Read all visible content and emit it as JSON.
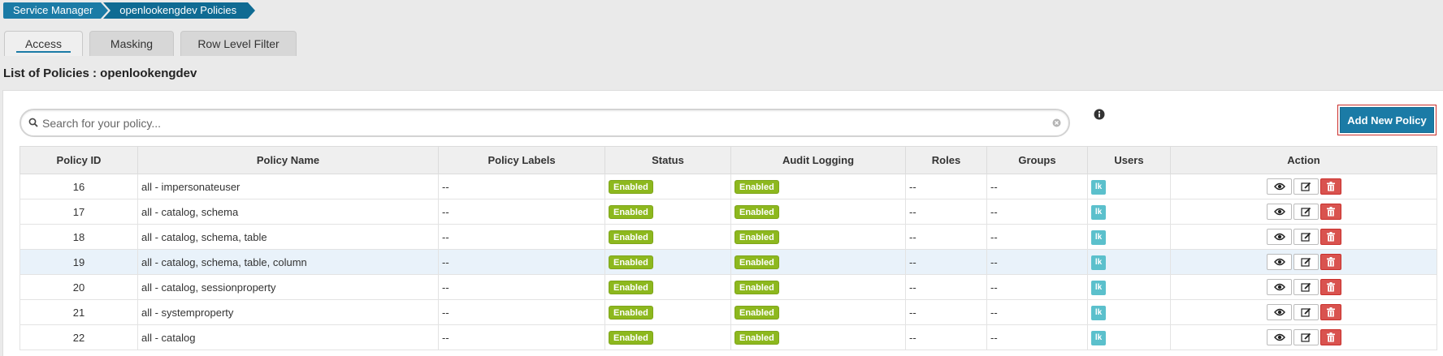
{
  "breadcrumb": {
    "root": "Service Manager",
    "current": "openlookengdev Policies"
  },
  "tabs": [
    {
      "label": "Access",
      "active": true
    },
    {
      "label": "Masking",
      "active": false
    },
    {
      "label": "Row Level Filter",
      "active": false
    }
  ],
  "page_title": "List of Policies : openlookengdev",
  "search": {
    "placeholder": "Search for your policy...",
    "value": ""
  },
  "add_button_label": "Add New Policy",
  "table": {
    "columns": [
      "Policy ID",
      "Policy Name",
      "Policy Labels",
      "Status",
      "Audit Logging",
      "Roles",
      "Groups",
      "Users",
      "Action"
    ],
    "rows": [
      {
        "id": "16",
        "name": "all - impersonateuser",
        "labels": "--",
        "status": "Enabled",
        "audit": "Enabled",
        "roles": "--",
        "groups": "--",
        "users": "lk"
      },
      {
        "id": "17",
        "name": "all - catalog, schema",
        "labels": "--",
        "status": "Enabled",
        "audit": "Enabled",
        "roles": "--",
        "groups": "--",
        "users": "lk"
      },
      {
        "id": "18",
        "name": "all - catalog, schema, table",
        "labels": "--",
        "status": "Enabled",
        "audit": "Enabled",
        "roles": "--",
        "groups": "--",
        "users": "lk"
      },
      {
        "id": "19",
        "name": "all - catalog, schema, table, column",
        "labels": "--",
        "status": "Enabled",
        "audit": "Enabled",
        "roles": "--",
        "groups": "--",
        "users": "lk"
      },
      {
        "id": "20",
        "name": "all - catalog, sessionproperty",
        "labels": "--",
        "status": "Enabled",
        "audit": "Enabled",
        "roles": "--",
        "groups": "--",
        "users": "lk"
      },
      {
        "id": "21",
        "name": "all - systemproperty",
        "labels": "--",
        "status": "Enabled",
        "audit": "Enabled",
        "roles": "--",
        "groups": "--",
        "users": "lk"
      },
      {
        "id": "22",
        "name": "all - catalog",
        "labels": "--",
        "status": "Enabled",
        "audit": "Enabled",
        "roles": "--",
        "groups": "--",
        "users": "lk"
      }
    ]
  },
  "colors": {
    "accent": "#1b7ba6",
    "enabled_badge": "#8db81e",
    "user_badge": "#5bc0cc",
    "delete": "#d9534f",
    "highlight_row": "#e9f2fa"
  }
}
